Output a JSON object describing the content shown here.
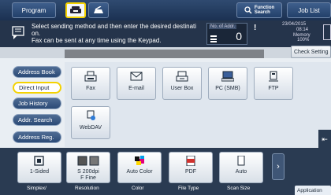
{
  "topbar": {
    "program": "Program",
    "function_search_line1": "Function",
    "function_search_line2": "Search",
    "job_list": "Job List"
  },
  "message": {
    "line1": "Select sending method and then enter the desired destinati",
    "line2": "on.",
    "line3": "Fax can be sent at any time using the Keypad."
  },
  "status": {
    "addr_label": "No. of Addr.",
    "addr_count": "0",
    "warning": "!",
    "date": "23/04/2015",
    "time": "08:14",
    "memory_label": "Memory",
    "memory_value": "100%"
  },
  "check_setting": "Check Setting",
  "nav": {
    "items": [
      {
        "label": "Address Book"
      },
      {
        "label": "Direct Input"
      },
      {
        "label": "Job History"
      },
      {
        "label": "Addr. Search"
      },
      {
        "label": "Address Reg."
      }
    ]
  },
  "destinations": [
    {
      "label": "Fax",
      "icon": "fax-icon"
    },
    {
      "label": "E-mail",
      "icon": "email-icon"
    },
    {
      "label": "User Box",
      "icon": "user-box-icon"
    },
    {
      "label": "PC (SMB)",
      "icon": "pc-icon"
    },
    {
      "label": "FTP",
      "icon": "ftp-icon"
    },
    {
      "label": "WebDAV",
      "icon": "webdav-icon"
    }
  ],
  "settings": [
    {
      "value": "1-Sided",
      "value2": "",
      "caption": "Simplex/\nDuplex"
    },
    {
      "value": "S 200dpi",
      "value2": "F Fine",
      "caption": "Resolution"
    },
    {
      "value": "Auto Color",
      "value2": "",
      "caption": "Color"
    },
    {
      "value": "PDF",
      "value2": "",
      "caption": "File Type"
    },
    {
      "value": "Auto",
      "value2": "",
      "caption": "Scan Size"
    }
  ],
  "settings_captions_short": [
    "Simplex/",
    "Resolution",
    "Color",
    "File Type",
    "Scan Size"
  ],
  "application": "Application"
}
